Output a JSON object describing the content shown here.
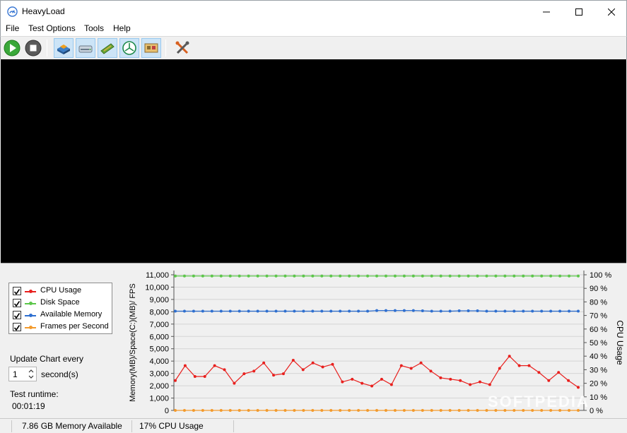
{
  "window": {
    "title": "HeavyLoad"
  },
  "menu": [
    "File",
    "Test Options",
    "Tools",
    "Help"
  ],
  "toolbar": {
    "buttons": [
      "start-icon",
      "stop-icon",
      "cpu-load-icon",
      "disk-write-icon",
      "memory-load-icon",
      "tree-walker-icon",
      "gpu-load-icon",
      "tools-icon"
    ]
  },
  "legend": {
    "items": [
      {
        "label": "CPU Usage",
        "color": "#e8201e",
        "checked": true
      },
      {
        "label": "Disk Space",
        "color": "#5cc64a",
        "checked": true
      },
      {
        "label": "Available Memory",
        "color": "#2e6fd0",
        "checked": true
      },
      {
        "label": "Frames per Second",
        "color": "#f39a2c",
        "checked": true
      }
    ]
  },
  "controls": {
    "update_label": "Update Chart every",
    "update_value": "1",
    "update_unit": "second(s)",
    "runtime_label": "Test runtime:",
    "runtime_value": "00:01:19"
  },
  "chart_data": {
    "type": "line",
    "ylabel": "Memory(MB)/Space(C:)(MB)/ FPS",
    "y2label": "CPU Usage",
    "ylim": [
      0,
      11000
    ],
    "y2lim": [
      0,
      100
    ],
    "y_ticks": [
      "0",
      "1,000",
      "2,000",
      "3,000",
      "4,000",
      "5,000",
      "6,000",
      "7,000",
      "8,000",
      "9,000",
      "10,000",
      "11,000"
    ],
    "y2_ticks": [
      "0 %",
      "10 %",
      "20 %",
      "30 %",
      "40 %",
      "50 %",
      "60 %",
      "70 %",
      "80 %",
      "90 %",
      "100 %"
    ],
    "grid": true,
    "series": [
      {
        "name": "Disk Space",
        "color": "#5cc64a",
        "axis": "left",
        "values": [
          10900,
          10900,
          10900,
          10900,
          10900,
          10900,
          10900,
          10900,
          10900,
          10900,
          10900,
          10900,
          10900,
          10900,
          10900,
          10900,
          10900,
          10900,
          10900,
          10900,
          10900,
          10900,
          10900,
          10900,
          10900,
          10900,
          10900,
          10900,
          10900,
          10900,
          10900,
          10900,
          10900,
          10900,
          10900,
          10900,
          10900,
          10900,
          10900,
          10900,
          10900,
          10900,
          10900,
          10900,
          10900
        ]
      },
      {
        "name": "Available Memory",
        "color": "#2e6fd0",
        "axis": "left",
        "values": [
          8050,
          8050,
          8050,
          8050,
          8050,
          8050,
          8050,
          8050,
          8050,
          8050,
          8050,
          8050,
          8050,
          8050,
          8050,
          8050,
          8050,
          8050,
          8050,
          8050,
          8050,
          8050,
          8100,
          8100,
          8100,
          8100,
          8100,
          8080,
          8050,
          8050,
          8050,
          8080,
          8080,
          8080,
          8050,
          8050,
          8050,
          8050,
          8050,
          8050,
          8050,
          8050,
          8050,
          8050,
          8050
        ]
      },
      {
        "name": "Frames per Second",
        "color": "#f39a2c",
        "axis": "left",
        "values": [
          0,
          0,
          0,
          0,
          0,
          0,
          0,
          0,
          0,
          0,
          0,
          0,
          0,
          0,
          0,
          0,
          0,
          0,
          0,
          0,
          0,
          0,
          0,
          0,
          0,
          0,
          0,
          0,
          0,
          0,
          0,
          0,
          0,
          0,
          0,
          0,
          0,
          0,
          0,
          0,
          0,
          0,
          0,
          0,
          0
        ]
      },
      {
        "name": "CPU Usage",
        "color": "#e8201e",
        "axis": "right",
        "unit": "%",
        "values": [
          22,
          33,
          25,
          25,
          33,
          30,
          20,
          27,
          29,
          35,
          26,
          27,
          37,
          30,
          35,
          32,
          34,
          21,
          23,
          20,
          18,
          23,
          19,
          33,
          31,
          35,
          29,
          24,
          23,
          22,
          19,
          21,
          19,
          31,
          40,
          33,
          33,
          28,
          22,
          28,
          22,
          17
        ]
      }
    ]
  },
  "status": {
    "memory": "7.86 GB Memory Available",
    "cpu": "17% CPU Usage"
  },
  "watermark": "SOFTPEDIA"
}
